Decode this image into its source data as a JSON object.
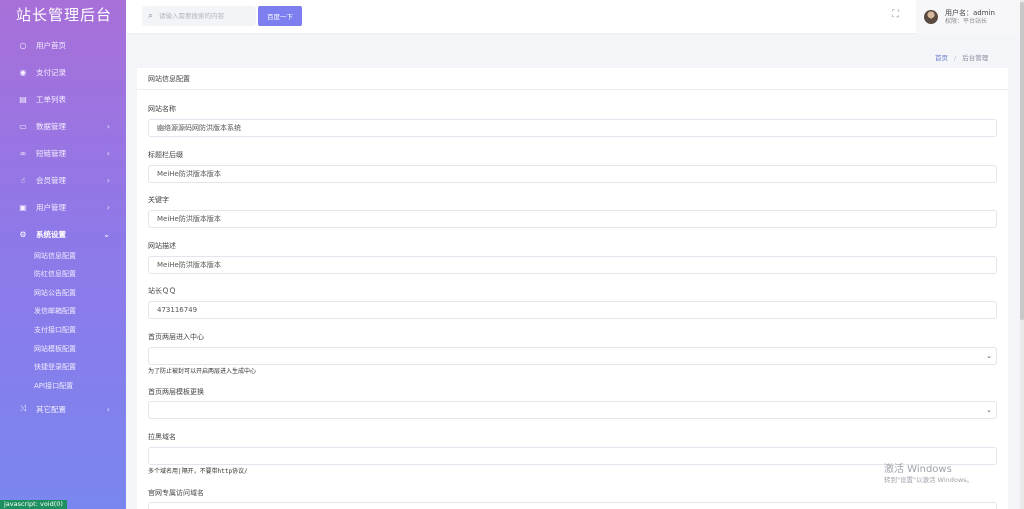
{
  "sidebar": {
    "brand": "站长管理后台",
    "items": [
      {
        "label": "用户首页"
      },
      {
        "label": "支付记录"
      },
      {
        "label": "工单列表"
      },
      {
        "label": "数据管理"
      },
      {
        "label": "短链管理"
      },
      {
        "label": "会员管理"
      },
      {
        "label": "用户管理"
      },
      {
        "label": "系统设置"
      },
      {
        "label": "其它配置"
      }
    ],
    "sub_items": [
      "网站信息配置",
      "防红信息配置",
      "网站公告配置",
      "发信邮箱配置",
      "支付接口配置",
      "网站模板配置",
      "快捷登录配置",
      "API接口配置"
    ]
  },
  "status_bar": "javascript: void(0)",
  "topbar": {
    "search_placeholder": "请输入需要搜索的内容",
    "search_button": "百度一下",
    "user_name": "用户名：admin",
    "user_role": "权限：平台站长"
  },
  "breadcrumb": {
    "home": "首页",
    "separator": "/",
    "current": "后台管理"
  },
  "card": {
    "title": "网站信息配置",
    "fields": {
      "site_name": {
        "label": "网站名称",
        "value": "幽络源源码网防洪版本系统"
      },
      "title_suffix": {
        "label": "标题栏后缀",
        "value": "MeiHe防洪版本版本"
      },
      "keywords": {
        "label": "关键字",
        "value": "MeiHe防洪版本版本"
      },
      "description": {
        "label": "网站描述",
        "value": "MeiHe防洪版本版本"
      },
      "qq": {
        "label": "站长ＱＱ",
        "value": "473116749"
      },
      "homepage_layer": {
        "label": "首页两层进入中心",
        "value": "",
        "hint": "为了防止被封可以开启两层进入生成中心"
      },
      "homepage_template": {
        "label": "首页两层模板更换",
        "value": ""
      },
      "block_domain": {
        "label": "拉黑域名",
        "value": "",
        "hint": "多个域名用|隔开，不要带http协议/"
      },
      "official_domain": {
        "label": "官网专属访问域名"
      }
    }
  },
  "watermark": {
    "line1": "激活 Windows",
    "line2": "转到\"设置\"以激活 Windows。"
  }
}
